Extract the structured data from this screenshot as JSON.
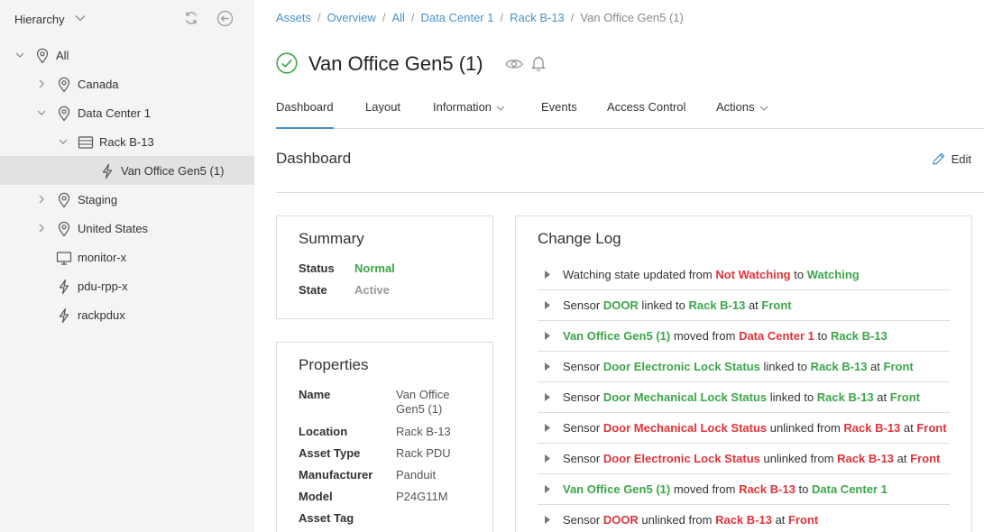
{
  "sidebar": {
    "title": "Hierarchy",
    "tree": [
      {
        "label": "All",
        "icon": "location-pin-icon",
        "twisty": "expanded"
      },
      {
        "label": "Canada",
        "icon": "location-pin-icon",
        "twisty": "collapsed"
      },
      {
        "label": "Data Center 1",
        "icon": "location-pin-icon",
        "twisty": "expanded"
      },
      {
        "label": "Rack B-13",
        "icon": "rack-icon",
        "twisty": "expanded"
      },
      {
        "label": "Van Office Gen5 (1)",
        "icon": "power-bolt-icon",
        "twisty": "none",
        "selected": true
      },
      {
        "label": "Staging",
        "icon": "location-pin-icon",
        "twisty": "collapsed"
      },
      {
        "label": "United States",
        "icon": "location-pin-icon",
        "twisty": "collapsed"
      },
      {
        "label": "monitor-x",
        "icon": "monitor-icon",
        "twisty": "none"
      },
      {
        "label": "pdu-rpp-x",
        "icon": "power-bolt-icon",
        "twisty": "none"
      },
      {
        "label": "rackpdux",
        "icon": "power-bolt-icon",
        "twisty": "none"
      }
    ]
  },
  "breadcrumb": {
    "items": [
      "Assets",
      "Overview",
      "All",
      "Data Center 1",
      "Rack B-13"
    ],
    "current": "Van Office Gen5 (1)",
    "separator": "/"
  },
  "header": {
    "title": "Van Office Gen5 (1)"
  },
  "tabs": [
    "Dashboard",
    "Layout",
    "Information",
    "Events",
    "Access Control",
    "Actions"
  ],
  "dashboard": {
    "title": "Dashboard",
    "edit_label": "Edit"
  },
  "summary": {
    "title": "Summary",
    "rows": [
      {
        "key": "Status",
        "value": "Normal"
      },
      {
        "key": "State",
        "value": "Active"
      }
    ]
  },
  "properties": {
    "title": "Properties",
    "rows": [
      {
        "key": "Name",
        "value": "Van Office Gen5 (1)"
      },
      {
        "key": "Location",
        "value": "Rack B-13"
      },
      {
        "key": "Asset Type",
        "value": "Rack PDU"
      },
      {
        "key": "Manufacturer",
        "value": "Panduit"
      },
      {
        "key": "Model",
        "value": "P24G11M"
      },
      {
        "key": "Asset Tag",
        "value": ""
      }
    ]
  },
  "changelog": {
    "title": "Change Log",
    "entries": [
      [
        [
          "Watching state updated from ",
          ""
        ],
        [
          "Not Watching",
          "r"
        ],
        [
          " to ",
          ""
        ],
        [
          "Watching",
          "g"
        ]
      ],
      [
        [
          "Sensor ",
          ""
        ],
        [
          "DOOR",
          "g"
        ],
        [
          " linked to ",
          ""
        ],
        [
          "Rack B-13",
          "g"
        ],
        [
          " at ",
          ""
        ],
        [
          "Front",
          "g"
        ]
      ],
      [
        [
          "Van Office Gen5 (1)",
          "g"
        ],
        [
          " moved from ",
          ""
        ],
        [
          "Data Center 1",
          "r"
        ],
        [
          " to ",
          ""
        ],
        [
          "Rack B-13",
          "g"
        ]
      ],
      [
        [
          "Sensor ",
          ""
        ],
        [
          "Door Electronic Lock Status",
          "g"
        ],
        [
          " linked to ",
          ""
        ],
        [
          "Rack B-13",
          "g"
        ],
        [
          " at ",
          ""
        ],
        [
          "Front",
          "g"
        ]
      ],
      [
        [
          "Sensor ",
          ""
        ],
        [
          "Door Mechanical Lock Status",
          "g"
        ],
        [
          " linked to ",
          ""
        ],
        [
          "Rack B-13",
          "g"
        ],
        [
          " at ",
          ""
        ],
        [
          "Front",
          "g"
        ]
      ],
      [
        [
          "Sensor ",
          ""
        ],
        [
          "Door Mechanical Lock Status",
          "r"
        ],
        [
          " unlinked from ",
          ""
        ],
        [
          "Rack B-13",
          "r"
        ],
        [
          " at ",
          ""
        ],
        [
          "Front",
          "r"
        ]
      ],
      [
        [
          "Sensor ",
          ""
        ],
        [
          "Door Electronic Lock Status",
          "r"
        ],
        [
          " unlinked from ",
          ""
        ],
        [
          "Rack B-13",
          "r"
        ],
        [
          " at ",
          ""
        ],
        [
          "Front",
          "r"
        ]
      ],
      [
        [
          "Van Office Gen5 (1)",
          "g"
        ],
        [
          " moved from ",
          ""
        ],
        [
          "Rack B-13",
          "r"
        ],
        [
          " to ",
          ""
        ],
        [
          "Data Center 1",
          "g"
        ]
      ],
      [
        [
          "Sensor ",
          ""
        ],
        [
          "DOOR",
          "r"
        ],
        [
          " unlinked from ",
          ""
        ],
        [
          "Rack B-13",
          "r"
        ],
        [
          " at ",
          ""
        ],
        [
          "Front",
          "r"
        ]
      ]
    ]
  },
  "colors": {
    "accent": "#4a90c8",
    "positive": "#3ca64a",
    "negative": "#e0333a",
    "sidebar_bg": "#f4f4f4",
    "selected_bg": "#e2e2e2"
  }
}
